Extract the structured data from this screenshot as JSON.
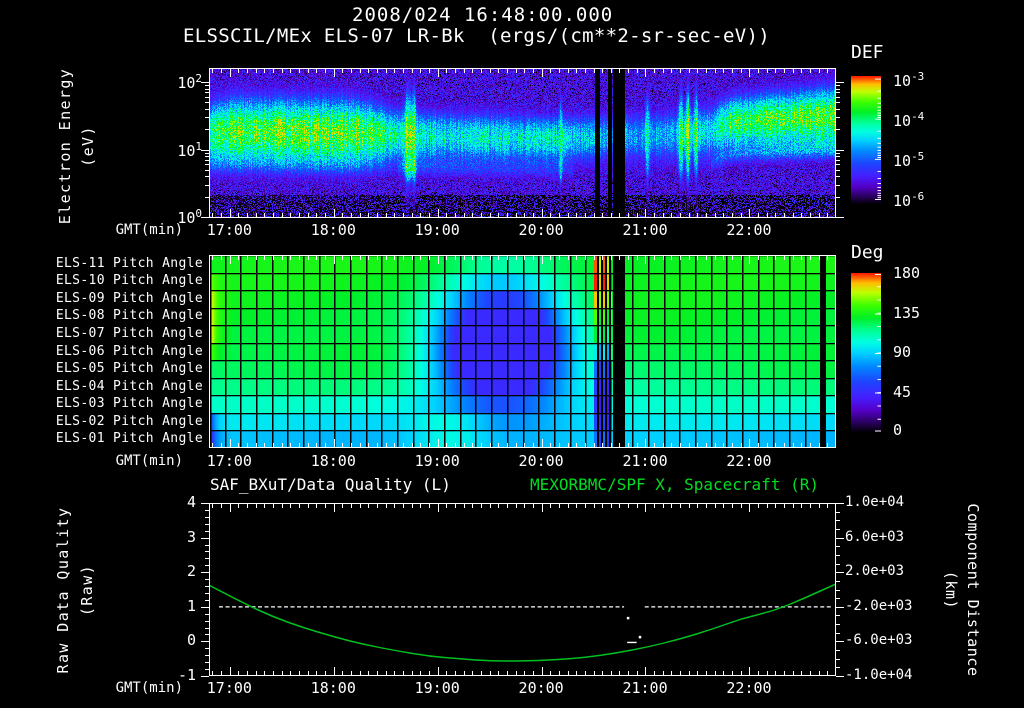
{
  "header": {
    "title": "2008/024 16:48:00.000",
    "subtitle": "ELSSCIL/MEx ELS-07 LR-Bk  (ergs/(cm**2-sr-sec-eV))"
  },
  "colors": {
    "background": "#000000",
    "foreground": "#ffffff",
    "right_title_green": "#00dd22",
    "curve_green": "#00c020"
  },
  "time_axis": {
    "label": "GMT(min)",
    "hour_labels": [
      "17:00",
      "18:00",
      "19:00",
      "20:00",
      "21:00",
      "22:00"
    ],
    "start": "16:48",
    "span_minutes": 362
  },
  "chart_data": [
    {
      "type": "heatmap",
      "name": "electron-energy-spectrogram",
      "title": "ELSSCIL/MEx ELS-07 LR-Bk",
      "units": "(ergs/(cm**2-sr-sec-eV))",
      "ylabel_line1": "Electron Energy",
      "ylabel_line2": "(eV)",
      "yscale": "log",
      "ytick_exponents": [
        "2",
        "1",
        "0"
      ],
      "ylim_ev": [
        1,
        160
      ],
      "xlabel": "GMT(min)",
      "xticks": [
        "17:00",
        "18:00",
        "19:00",
        "20:00",
        "21:00",
        "22:00"
      ],
      "colorbar": {
        "title": "DEF",
        "tick_exponents": [
          "-3",
          "-4",
          "-5",
          "-6"
        ],
        "range": [
          1e-06,
          0.001
        ]
      },
      "band_keyframes": [
        [
          0.0,
          0.44,
          0.16,
          0.88
        ],
        [
          0.035,
          0.42,
          0.17,
          1.0
        ],
        [
          0.23,
          0.43,
          0.17,
          1.0
        ],
        [
          0.27,
          0.44,
          0.15,
          0.9
        ],
        [
          0.31,
          0.45,
          0.13,
          0.72
        ],
        [
          0.55,
          0.47,
          0.12,
          0.7
        ],
        [
          0.61,
          0.46,
          0.12,
          0.6
        ],
        [
          0.7,
          0.45,
          0.13,
          0.55
        ],
        [
          0.76,
          0.44,
          0.13,
          0.62
        ],
        [
          0.8,
          0.42,
          0.13,
          0.72
        ],
        [
          0.83,
          0.36,
          0.13,
          0.88
        ],
        [
          0.92,
          0.34,
          0.14,
          0.95
        ],
        [
          1.0,
          0.32,
          0.15,
          1.0
        ]
      ],
      "streaks": [
        [
          0.317,
          0.01,
          0.45
        ],
        [
          0.327,
          0.005,
          0.25
        ],
        [
          0.56,
          0.004,
          0.2
        ],
        [
          0.655,
          0.004,
          0.3
        ],
        [
          0.699,
          0.005,
          0.35
        ],
        [
          0.752,
          0.006,
          0.5
        ],
        [
          0.763,
          0.006,
          0.5
        ],
        [
          0.776,
          0.005,
          0.35
        ]
      ],
      "gaps": [
        [
          0.6156,
          0.6236
        ],
        [
          0.6348,
          0.6427
        ],
        [
          0.6443,
          0.6619
        ]
      ]
    },
    {
      "type": "heatmap",
      "name": "pitch-angle-panel",
      "row_labels": [
        "ELS-11 Pitch Angle",
        "ELS-10 Pitch Angle",
        "ELS-09 Pitch Angle",
        "ELS-08 Pitch Angle",
        "ELS-07 Pitch Angle",
        "ELS-06 Pitch Angle",
        "ELS-05 Pitch Angle",
        "ELS-04 Pitch Angle",
        "ELS-03 Pitch Angle",
        "ELS-02 Pitch Angle",
        "ELS-01 Pitch Angle"
      ],
      "xlabel": "GMT(min)",
      "xticks": [
        "17:00",
        "18:00",
        "19:00",
        "20:00",
        "21:00",
        "22:00"
      ],
      "colorbar": {
        "title": "Deg",
        "ticks": [
          "180",
          "135",
          "90",
          "45",
          "0"
        ],
        "range": [
          0,
          180
        ]
      },
      "columns": 40,
      "row_base_deg": [
        133,
        132,
        131,
        130,
        129,
        128,
        124,
        116,
        104,
        94,
        87
      ],
      "features": {
        "left_yellow": {
          "deg": 160,
          "strong_rows": [
            2,
            4
          ],
          "soft_rows": [
            1,
            5
          ]
        },
        "left_blue": [
          {
            "row": 9,
            "deg": 40
          },
          {
            "row": 10,
            "deg": 22
          }
        ],
        "blob": {
          "t": 0.468,
          "row": 5.3,
          "sigma_t": 0.07,
          "sigma_rows": 2.3,
          "deg": 45,
          "strength": 1.9
        },
        "bottom_green_bump": {
          "t": 0.385,
          "sigma_t": 0.045,
          "rows": [
            9,
            10
          ],
          "deg_delta": 18
        },
        "stripe_region": {
          "t0": 0.614,
          "t1": 0.6427,
          "row_deg": [
            168,
            174,
            160,
            138,
            120,
            90,
            60,
            48,
            42,
            50,
            62
          ]
        },
        "black_bars": [
          [
            0.6443,
            0.6619
          ],
          [
            0.9745,
            0.984
          ]
        ]
      }
    },
    {
      "type": "line",
      "name": "quality-distance-plot",
      "title_left": "SAF_BXuT/Data Quality (L)",
      "title_right": "MEXORBMC/SPF X, Spacecraft (R)",
      "ylabel_left_line1": "Raw Data Quality",
      "ylabel_left_line2": "(Raw)",
      "yticks_left": [
        "4",
        "3",
        "2",
        "1",
        "0",
        "-1"
      ],
      "ylim_left": [
        -1,
        4
      ],
      "ylabel_right_line1": "Component Distance",
      "ylabel_right_line2": "(km)",
      "yticks_right": [
        "1.0e+04",
        "6.0e+03",
        "2.0e+03",
        "-2.0e+03",
        "-6.0e+03",
        "-1.0e+04"
      ],
      "ylim_right": [
        -10000,
        10000
      ],
      "xlabel": "GMT(min)",
      "xticks": [
        "17:00",
        "18:00",
        "19:00",
        "20:00",
        "21:00",
        "22:00"
      ],
      "series": [
        {
          "name": "SAF_BXuT/Data Quality",
          "axis": "left",
          "color": "#ffffff",
          "style": "dashed",
          "segments": [
            {
              "t0": 0.016,
              "t1": 0.662,
              "value": 1
            },
            {
              "t0": 0.695,
              "t1": 0.993,
              "value": 1
            }
          ],
          "dropout_markers": [
            {
              "t": 0.668,
              "value": 0.68
            },
            {
              "t": 0.687,
              "value": 0.13
            }
          ],
          "dropout_dash": {
            "t0": 0.667,
            "t1": 0.682,
            "value": -0.01
          }
        },
        {
          "name": "MEXORBMC/SPF X Spacecraft",
          "axis": "right",
          "color": "#00c020",
          "style": "solid",
          "points_t_km": [
            [
              0,
              500
            ],
            [
              0.05,
              -1400
            ],
            [
              0.1,
              -3100
            ],
            [
              0.15,
              -4400
            ],
            [
              0.2,
              -5500
            ],
            [
              0.25,
              -6400
            ],
            [
              0.3,
              -7100
            ],
            [
              0.35,
              -7700
            ],
            [
              0.4,
              -8050
            ],
            [
              0.45,
              -8230
            ],
            [
              0.5,
              -8280
            ],
            [
              0.55,
              -8150
            ],
            [
              0.6,
              -7850
            ],
            [
              0.65,
              -7350
            ],
            [
              0.7,
              -6650
            ],
            [
              0.75,
              -5750
            ],
            [
              0.8,
              -4650
            ],
            [
              0.85,
              -3350
            ],
            [
              0.9,
              -2500
            ],
            [
              0.95,
              -1000
            ],
            [
              1.0,
              650
            ]
          ]
        }
      ]
    }
  ]
}
